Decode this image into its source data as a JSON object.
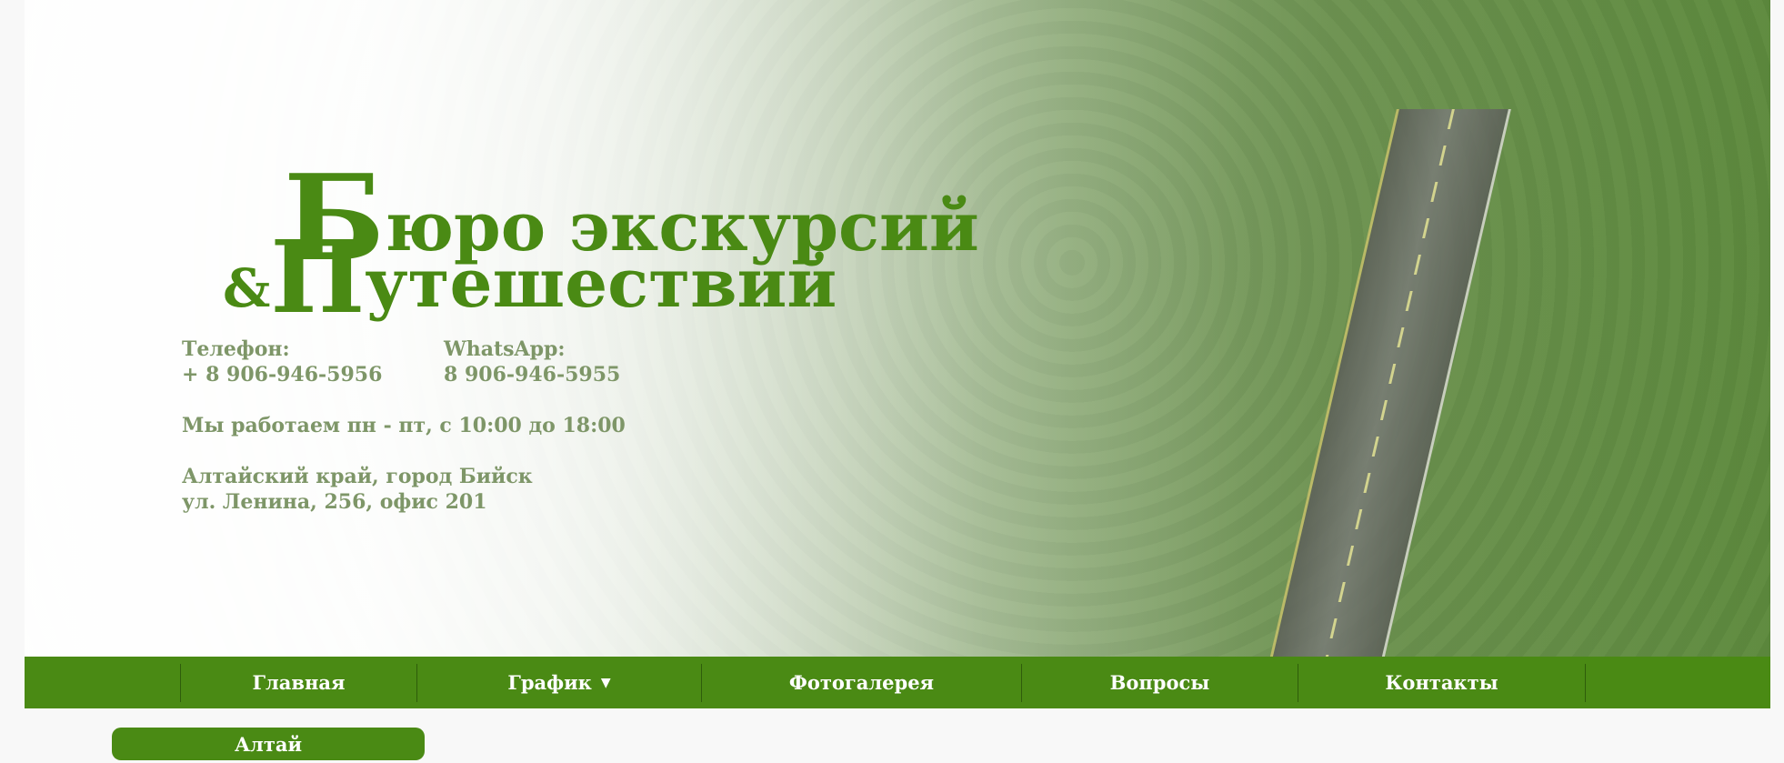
{
  "header": {
    "title_line1_cap": "Б",
    "title_line1_rest": "юро экскурсий",
    "title_line2_amp": "&",
    "title_line2_cap": "П",
    "title_line2_rest": "утешествий"
  },
  "contacts": {
    "phone_label": "Телефон:",
    "phone_value": "+ 8 906-946-5956",
    "whatsapp_label": "WhatsApp:",
    "whatsapp_value": "8 906-946-5955",
    "hours": "Мы работаем пн - пт, с 10:00 до 18:00",
    "address_line1": "Алтайский край, город Бийск",
    "address_line2": "ул. Ленина, 256, офис 201"
  },
  "nav": {
    "items": [
      {
        "label": "Главная"
      },
      {
        "label": "График",
        "icon": "caret-down-icon",
        "caret": "▼"
      },
      {
        "label": "Фотогалерея"
      },
      {
        "label": "Вопросы"
      },
      {
        "label": "Контакты"
      }
    ]
  },
  "submenu": {
    "item": "Алтай"
  },
  "colors": {
    "brand_green": "#4a8a14",
    "contact_text": "#7e9668",
    "nav_text": "#ffffff"
  }
}
